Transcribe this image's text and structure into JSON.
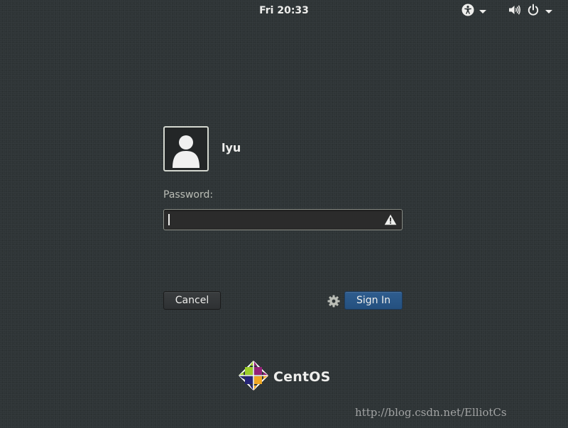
{
  "top_bar": {
    "clock": "Fri 20:33",
    "icons": {
      "accessibility": "accessibility-icon",
      "volume": "volume-icon",
      "power": "power-icon",
      "menu_arrow": "chevron-down-icon"
    }
  },
  "login": {
    "avatar_icon": "user-avatar-icon",
    "username": "lyu",
    "password_label": "Password:",
    "password_value": "",
    "warning_icon": "warning-icon",
    "cancel_label": "Cancel",
    "session_icon": "gear-icon",
    "sign_in_label": "Sign In"
  },
  "branding": {
    "logo_icon": "centos-logo-icon",
    "name": "CentOS"
  },
  "watermark": "http://blog.csdn.net/ElliotCs",
  "colors": {
    "background": "#2e3436",
    "text": "#eeeeec",
    "sign_in_button": "#2a5688",
    "cancel_button": "#33373a",
    "field_border": "#8a8e87"
  }
}
